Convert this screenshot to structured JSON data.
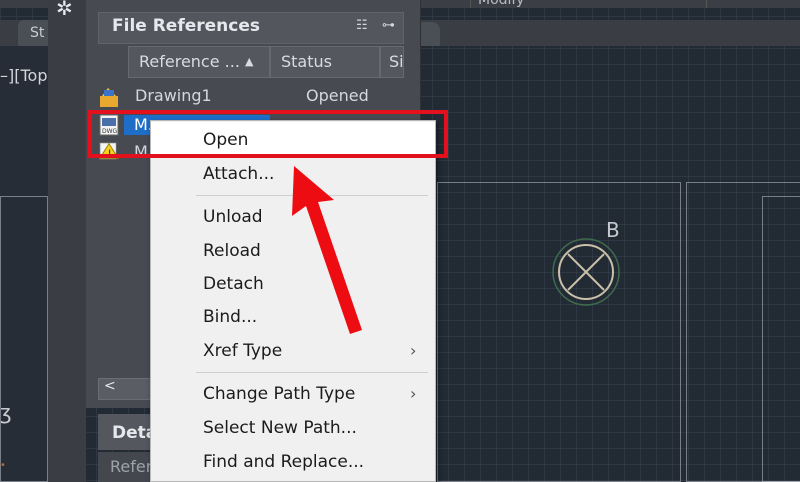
{
  "ribbon": {
    "panel_label": "Modify"
  },
  "tabs": {
    "active_prefix": "St"
  },
  "viewport": {
    "label": "–][Top"
  },
  "drawing": {
    "bubble_label": "B"
  },
  "palette": {
    "title": "File References",
    "columns": [
      {
        "label": "Reference ...",
        "sort": "ascending"
      },
      {
        "label": "Status"
      },
      {
        "label": "Si"
      }
    ],
    "rows": [
      {
        "name": "Drawing1",
        "status": "Opened",
        "icon": "drawing-icon"
      },
      {
        "name": "M...",
        "status": "",
        "icon": "dwg-file-icon",
        "selected": true
      },
      {
        "name": "M",
        "status": "",
        "icon": "warning-file-icon"
      }
    ],
    "scroll_left_label": "<",
    "details_title": "Deta",
    "details_ref_label": "Refer"
  },
  "context_menu": {
    "items": [
      {
        "label": "Open",
        "highlighted": true
      },
      {
        "label": "Attach..."
      },
      {
        "label": "Unload"
      },
      {
        "label": "Reload"
      },
      {
        "label": "Detach"
      },
      {
        "label": "Bind..."
      },
      {
        "label": "Xref Type",
        "submenu": true
      },
      {
        "label": "Change Path Type",
        "submenu": true
      },
      {
        "label": "Select New Path..."
      },
      {
        "label": "Find and Replace..."
      }
    ]
  },
  "annotation": {
    "highlight_color": "#e3101d",
    "arrow_color": "#ee0c13"
  }
}
